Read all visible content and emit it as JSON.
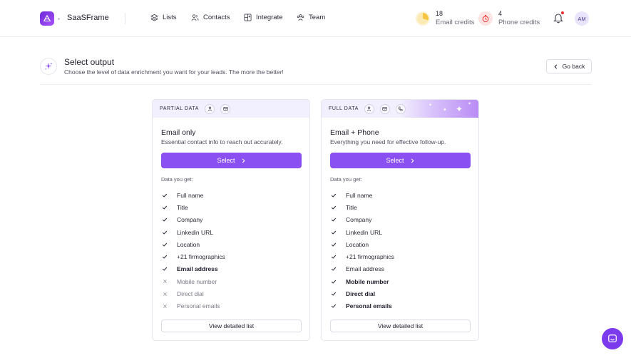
{
  "app": {
    "brand": "SaaSFrame"
  },
  "nav": [
    {
      "label": "Lists",
      "icon": "layers-icon"
    },
    {
      "label": "Contacts",
      "icon": "users-icon"
    },
    {
      "label": "Integrate",
      "icon": "integrate-icon"
    },
    {
      "label": "Team",
      "icon": "team-icon"
    }
  ],
  "credits": {
    "email": {
      "count": "18",
      "label": "Email credits",
      "color": "#f5c542"
    },
    "phone": {
      "count": "4",
      "label": "Phone credits",
      "color": "#ef2b2b"
    }
  },
  "user": {
    "initials": "AM"
  },
  "page": {
    "title": "Select output",
    "subtitle": "Choose the level of data enrichment you want for your leads. The more the better!",
    "go_back": "Go back"
  },
  "cards": [
    {
      "header": "PARTIAL DATA",
      "title": "Email only",
      "desc": "Essential contact info to reach out accurately.",
      "select": "Select",
      "data_label": "Data you get:",
      "features": [
        {
          "label": "Full name",
          "included": true,
          "bold": false
        },
        {
          "label": "Title",
          "included": true,
          "bold": false
        },
        {
          "label": "Company",
          "included": true,
          "bold": false
        },
        {
          "label": "Linkedin URL",
          "included": true,
          "bold": false
        },
        {
          "label": "Location",
          "included": true,
          "bold": false
        },
        {
          "label": "+21 firmographics",
          "included": true,
          "bold": false
        },
        {
          "label": "Email address",
          "included": true,
          "bold": true
        },
        {
          "label": "Mobile number",
          "included": false,
          "bold": false
        },
        {
          "label": "Direct dial",
          "included": false,
          "bold": false
        },
        {
          "label": "Personal emails",
          "included": false,
          "bold": false
        }
      ],
      "detail": "View detailed list"
    },
    {
      "header": "FULL DATA",
      "title": "Email + Phone",
      "desc": "Everything you need for effective follow-up.",
      "select": "Select",
      "data_label": "Data you get:",
      "features": [
        {
          "label": "Full name",
          "included": true,
          "bold": false
        },
        {
          "label": "Title",
          "included": true,
          "bold": false
        },
        {
          "label": "Company",
          "included": true,
          "bold": false
        },
        {
          "label": "Linkedin URL",
          "included": true,
          "bold": false
        },
        {
          "label": "Location",
          "included": true,
          "bold": false
        },
        {
          "label": "+21 firmographics",
          "included": true,
          "bold": false
        },
        {
          "label": "Email address",
          "included": true,
          "bold": false
        },
        {
          "label": "Mobile number",
          "included": true,
          "bold": true
        },
        {
          "label": "Direct dial",
          "included": true,
          "bold": true
        },
        {
          "label": "Personal emails",
          "included": true,
          "bold": true
        }
      ],
      "detail": "View detailed list"
    }
  ],
  "colors": {
    "accent": "#8b50f2",
    "header_bg": "#f2effe"
  }
}
